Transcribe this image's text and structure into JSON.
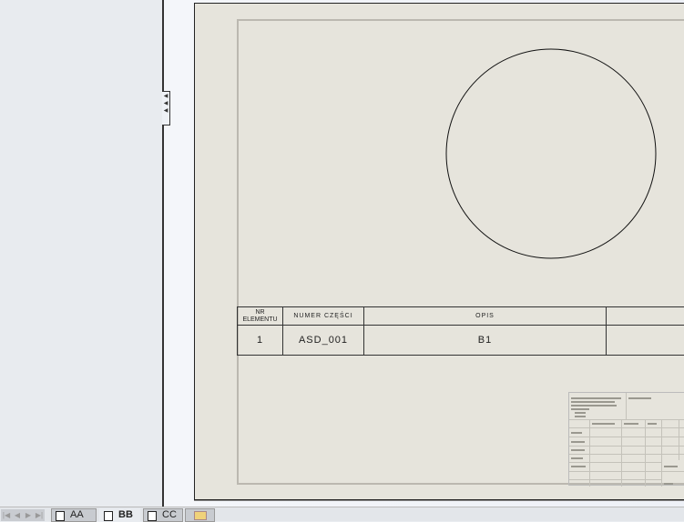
{
  "sheet_tabs": [
    {
      "label": "AA",
      "active": false
    },
    {
      "label": "BB",
      "active": true
    },
    {
      "label": "CC",
      "active": false
    }
  ],
  "bom_table": {
    "headers": [
      "NR\nELEMENTU",
      "NUMER CZĘŚCI",
      "OPIS",
      ""
    ],
    "rows": [
      [
        "1",
        "ASD_001",
        "B1",
        ""
      ]
    ]
  },
  "colors": {
    "sheet": "#e6e4dc",
    "panel": "#e8ebef"
  },
  "icons": [
    "collapse-panel-icon",
    "sheet-icon",
    "add-sheet-icon"
  ]
}
